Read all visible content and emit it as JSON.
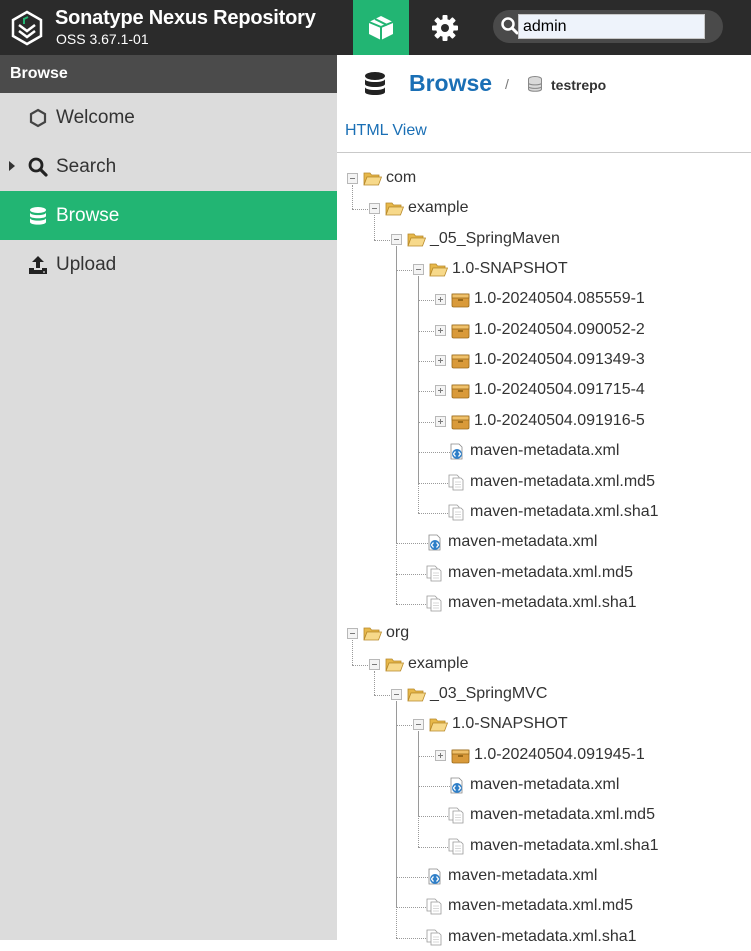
{
  "header": {
    "app_title": "Sonatype Nexus Repository",
    "version": "OSS 3.67.1-01",
    "browse_mode_icon": "cube-icon",
    "admin_mode_icon": "gear-icon",
    "search": {
      "value": "admin",
      "icon": "search-icon"
    },
    "accent": "#22b573",
    "bg": "#2b2b2b"
  },
  "sidebar": {
    "heading": "Browse",
    "items": [
      {
        "label": "Welcome",
        "icon": "hexagon-icon"
      },
      {
        "label": "Search",
        "icon": "search-icon"
      },
      {
        "label": "Browse",
        "icon": "database-icon"
      },
      {
        "label": "Upload",
        "icon": "upload-icon"
      }
    ]
  },
  "content": {
    "title": "Browse",
    "separator": "/",
    "repo": "testrepo",
    "html_view": "HTML View",
    "link_color": "#1a6fb5"
  },
  "tree": [
    {
      "label": "com",
      "type": "folder"
    },
    {
      "label": "example",
      "type": "folder"
    },
    {
      "label": "_05_SpringMaven",
      "type": "folder"
    },
    {
      "label": "1.0-SNAPSHOT",
      "type": "folder"
    },
    {
      "label": "1.0-20240504.085559-1",
      "type": "package"
    },
    {
      "label": "1.0-20240504.090052-2",
      "type": "package"
    },
    {
      "label": "1.0-20240504.091349-3",
      "type": "package"
    },
    {
      "label": "1.0-20240504.091715-4",
      "type": "package"
    },
    {
      "label": "1.0-20240504.091916-5",
      "type": "package"
    },
    {
      "label": "maven-metadata.xml",
      "type": "xml"
    },
    {
      "label": "maven-metadata.xml.md5",
      "type": "file"
    },
    {
      "label": "maven-metadata.xml.sha1",
      "type": "file"
    },
    {
      "label": "maven-metadata.xml",
      "type": "xml"
    },
    {
      "label": "maven-metadata.xml.md5",
      "type": "file"
    },
    {
      "label": "maven-metadata.xml.sha1",
      "type": "file"
    },
    {
      "label": "org",
      "type": "folder"
    },
    {
      "label": "example",
      "type": "folder"
    },
    {
      "label": "_03_SpringMVC",
      "type": "folder"
    },
    {
      "label": "1.0-SNAPSHOT",
      "type": "folder"
    },
    {
      "label": "1.0-20240504.091945-1",
      "type": "package"
    },
    {
      "label": "maven-metadata.xml",
      "type": "xml"
    },
    {
      "label": "maven-metadata.xml.md5",
      "type": "file"
    },
    {
      "label": "maven-metadata.xml.sha1",
      "type": "file"
    },
    {
      "label": "maven-metadata.xml",
      "type": "xml"
    },
    {
      "label": "maven-metadata.xml.md5",
      "type": "file"
    },
    {
      "label": "maven-metadata.xml.sha1",
      "type": "file"
    }
  ]
}
